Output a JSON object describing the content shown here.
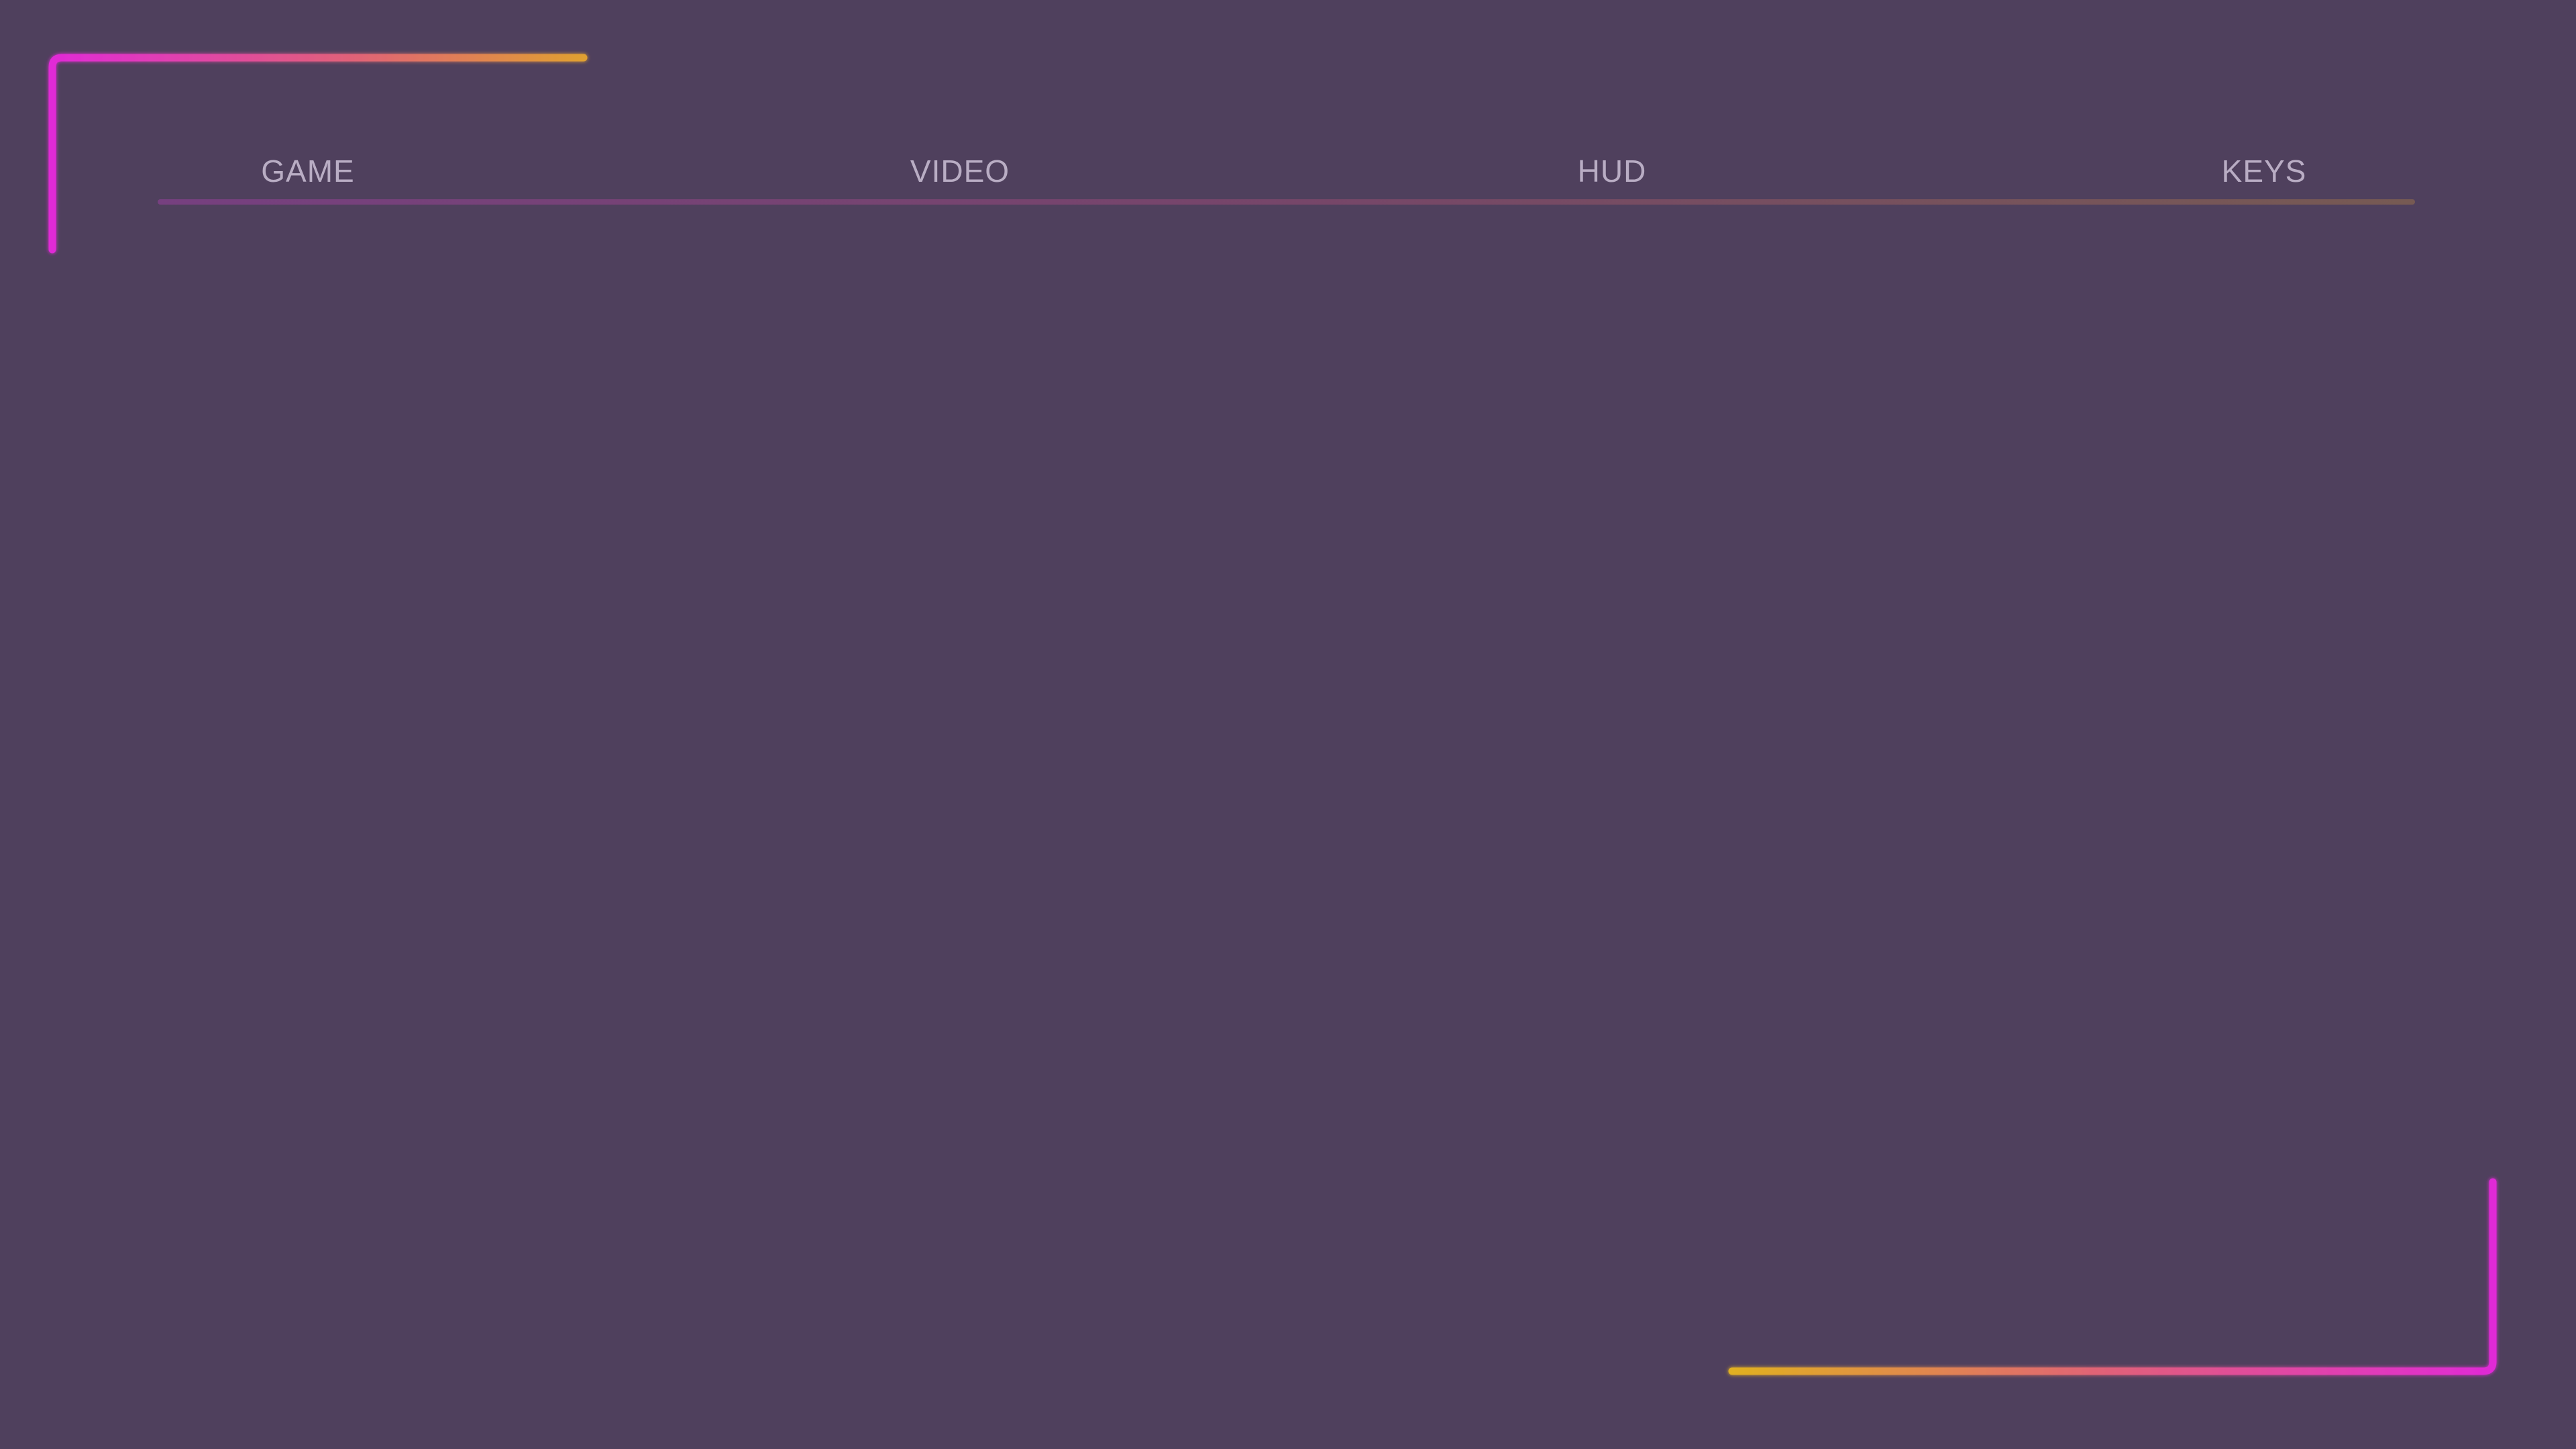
{
  "tabs": [
    {
      "label": "GAME"
    },
    {
      "label": "VIDEO"
    },
    {
      "label": "HUD"
    },
    {
      "label": "KEYS"
    }
  ],
  "colors": {
    "background": "#4f405d",
    "tab_text": "#b9adc4",
    "accent_magenta": "#e02ad6",
    "accent_orange": "#e08a3a",
    "accent_yellow": "#e0b22a"
  }
}
